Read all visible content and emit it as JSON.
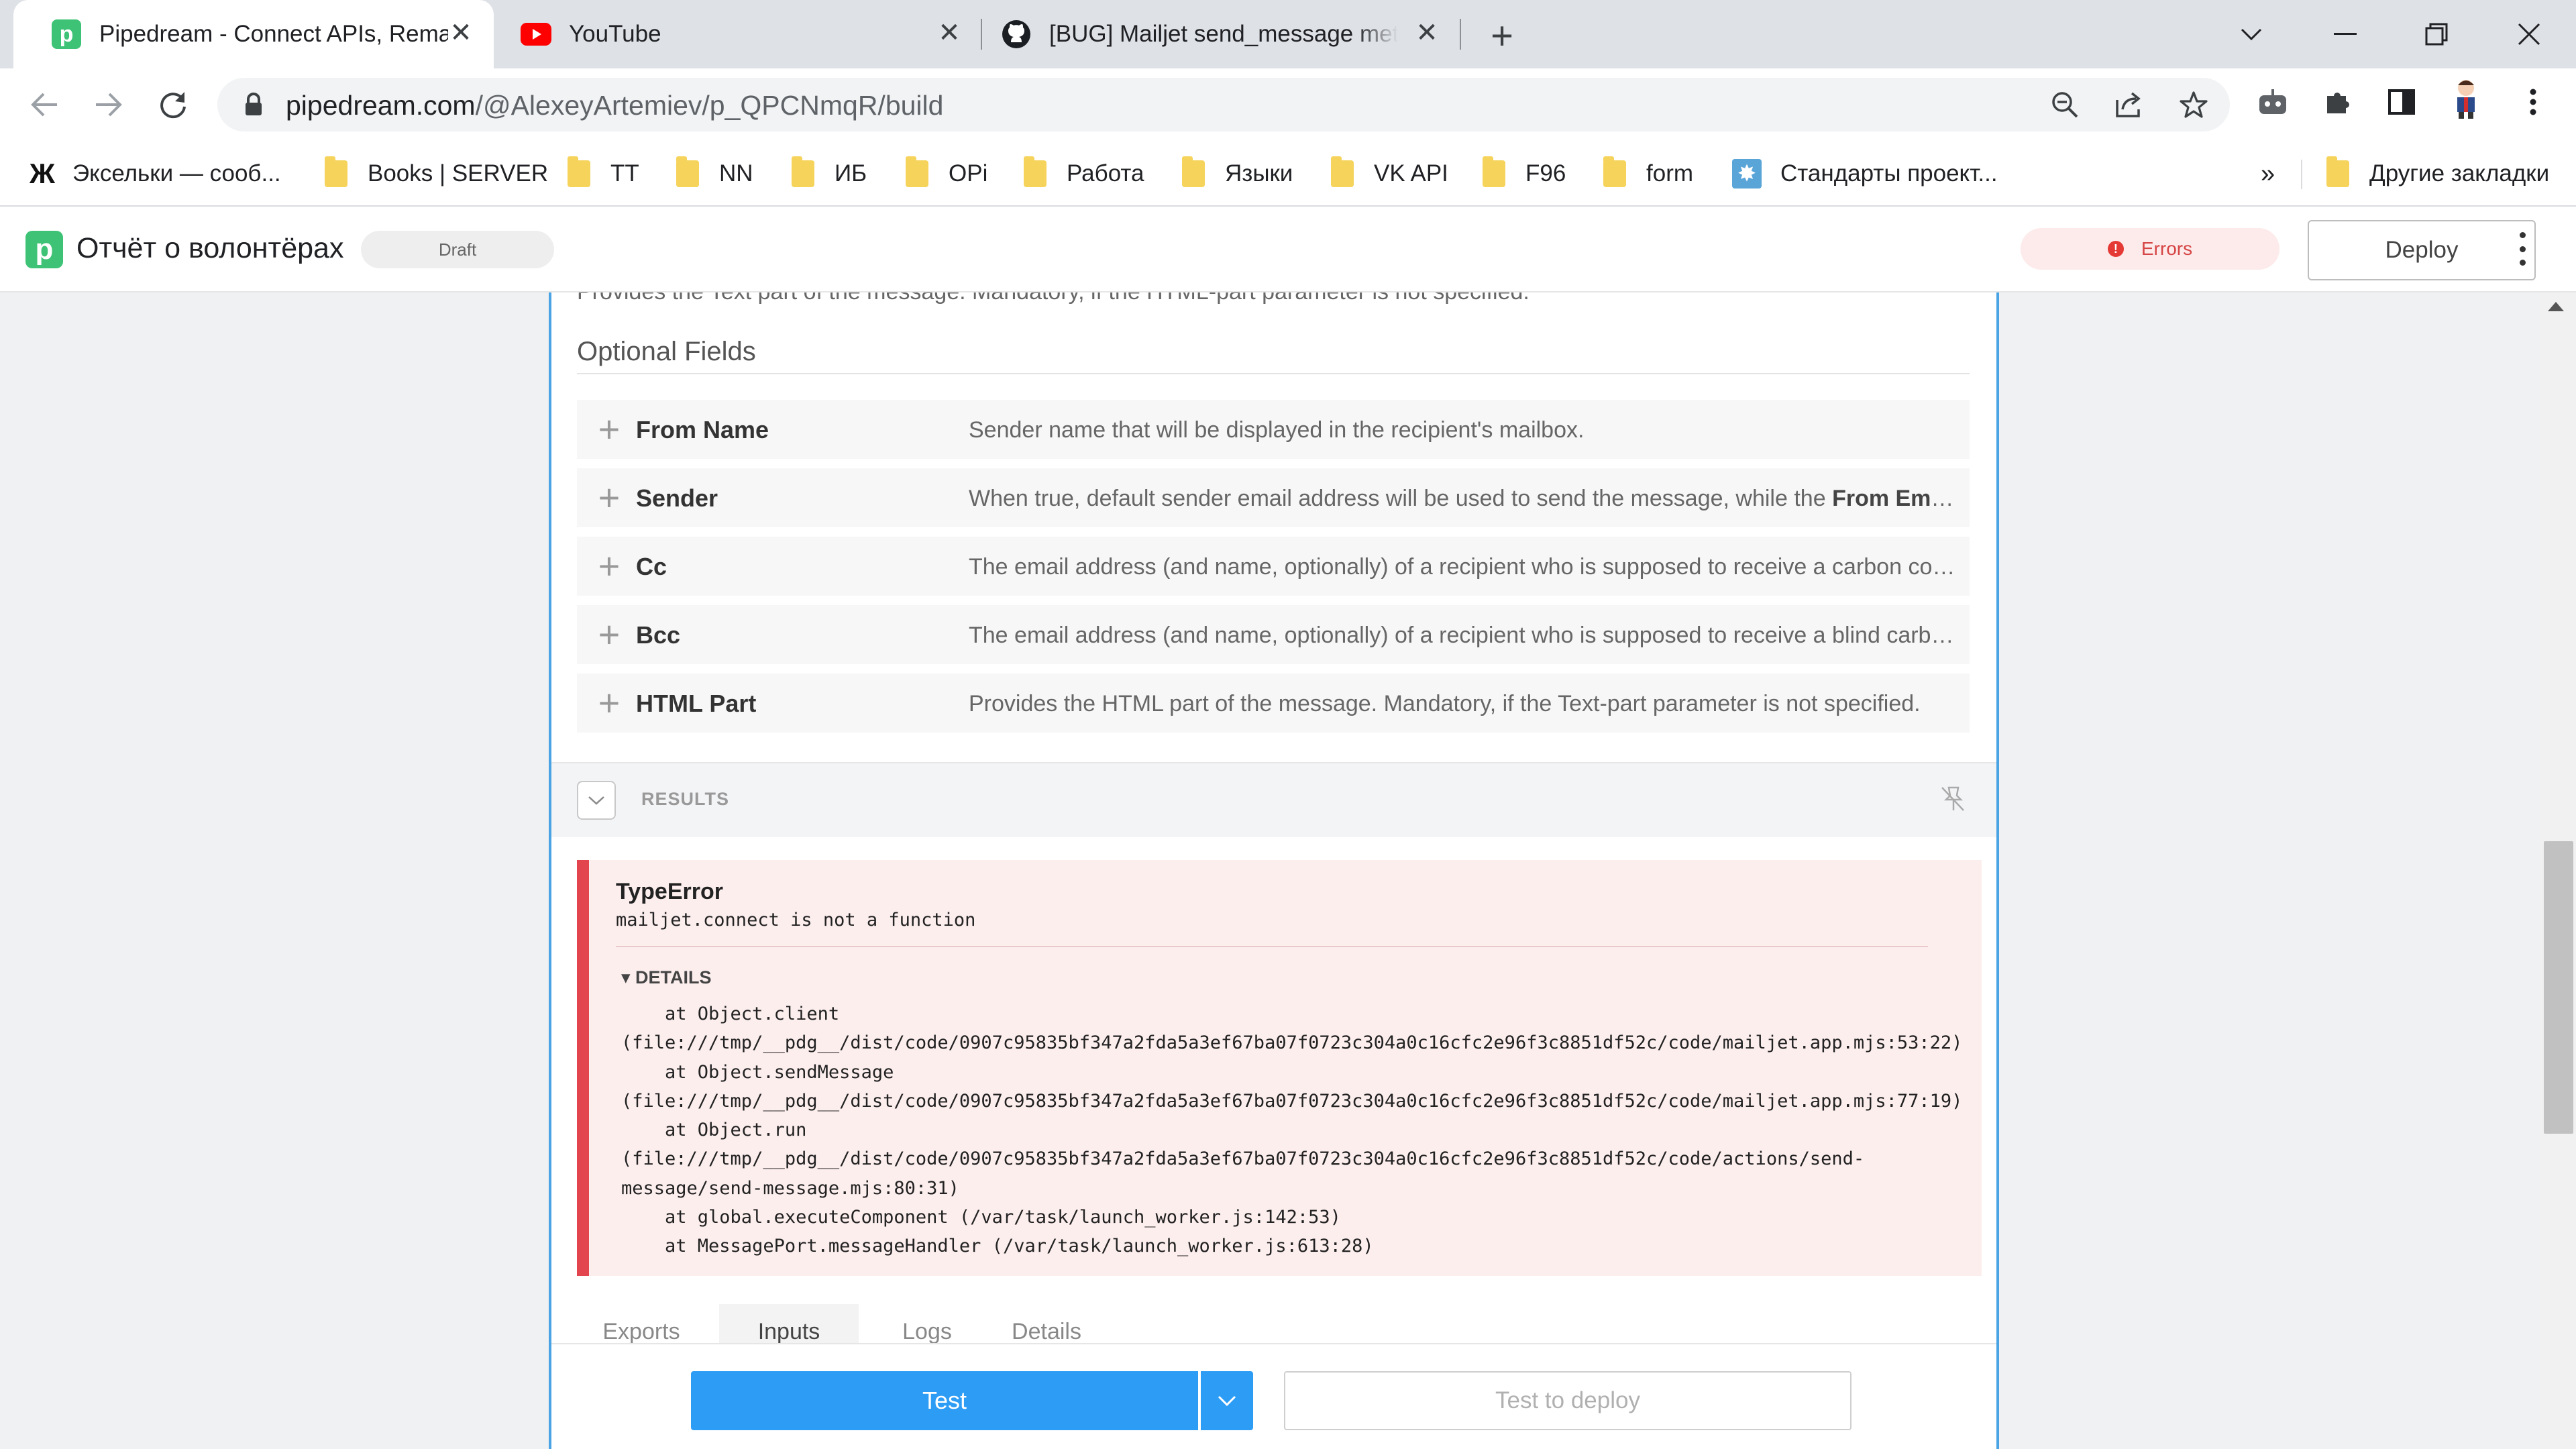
{
  "browser": {
    "tabs": [
      {
        "title": "Pipedream - Connect APIs, Remarkably Fast",
        "favicon": "pipedream-icon",
        "active": true
      },
      {
        "title": "YouTube",
        "favicon": "youtube-icon",
        "active": false
      },
      {
        "title": "[BUG] Mailjet send_message method",
        "favicon": "github-icon",
        "active": false
      }
    ],
    "url_host": "pipedream.com",
    "url_path": "/@AlexeyArtemiev/p_QPCNmqR/build"
  },
  "bookmarks": {
    "items": [
      {
        "label": "Эксельки — сооб...",
        "icon": "zh-icon"
      },
      {
        "label": "Books | SERVER",
        "icon": "folder-icon"
      },
      {
        "label": "TT",
        "icon": "folder-icon"
      },
      {
        "label": "NN",
        "icon": "folder-icon"
      },
      {
        "label": "ИБ",
        "icon": "folder-icon"
      },
      {
        "label": "OPi",
        "icon": "folder-icon"
      },
      {
        "label": "Работа",
        "icon": "folder-icon"
      },
      {
        "label": "Языки",
        "icon": "folder-icon"
      },
      {
        "label": "VK API",
        "icon": "folder-icon"
      },
      {
        "label": "F96",
        "icon": "folder-icon"
      },
      {
        "label": "form",
        "icon": "folder-icon"
      },
      {
        "label": "Стандарты проект...",
        "icon": "gear-favicon"
      }
    ],
    "more": "»",
    "other": "Другие закладки"
  },
  "app": {
    "workflow_title": "Отчёт о волонтёрах",
    "status": "Draft",
    "errors_label": "Errors",
    "errors_mark": "!",
    "deploy_label": "Deploy"
  },
  "step": {
    "cut_text": "Provides the Text part of the message. Mandatory, if the HTML-part parameter is not specified.",
    "optional_title": "Optional Fields",
    "fields": [
      {
        "name": "From Name",
        "desc": "Sender name that will be displayed in the recipient's mailbox."
      },
      {
        "name": "Sender",
        "desc_pre": "When true, default sender email address will be used to send the message, while the ",
        "desc_bold": "From Email",
        "desc_post": " ..."
      },
      {
        "name": "Cc",
        "desc": "The email address (and name, optionally) of a recipient who is supposed to receive a carbon copy..."
      },
      {
        "name": "Bcc",
        "desc": "The email address (and name, optionally) of a recipient who is supposed to receive a blind carbo..."
      },
      {
        "name": "HTML Part",
        "desc": "Provides the HTML part of the message. Mandatory, if the Text-part parameter is not specified."
      }
    ],
    "results_label": "RESULTS",
    "error": {
      "type": "TypeError",
      "message": "mailjet.connect is not a function",
      "details_label": "▾ DETAILS",
      "stack": [
        "    at Object.client",
        "(file:///tmp/__pdg__/dist/code/0907c95835bf347a2fda5a3ef67ba07f0723c304a0c16cfc2e96f3c8851df52c/code/mailjet.app.mjs:53:22)",
        "    at Object.sendMessage",
        "(file:///tmp/__pdg__/dist/code/0907c95835bf347a2fda5a3ef67ba07f0723c304a0c16cfc2e96f3c8851df52c/code/mailjet.app.mjs:77:19)",
        "    at Object.run",
        "(file:///tmp/__pdg__/dist/code/0907c95835bf347a2fda5a3ef67ba07f0723c304a0c16cfc2e96f3c8851df52c/code/actions/send-",
        "message/send-message.mjs:80:31)",
        "    at global.executeComponent (/var/task/launch_worker.js:142:53)",
        "    at MessagePort.messageHandler (/var/task/launch_worker.js:613:28)"
      ]
    },
    "result_tabs": [
      "Exports",
      "Inputs",
      "Logs",
      "Details"
    ],
    "selected_tab": "Inputs",
    "test_label": "Test",
    "test_deploy_label": "Test to deploy"
  }
}
